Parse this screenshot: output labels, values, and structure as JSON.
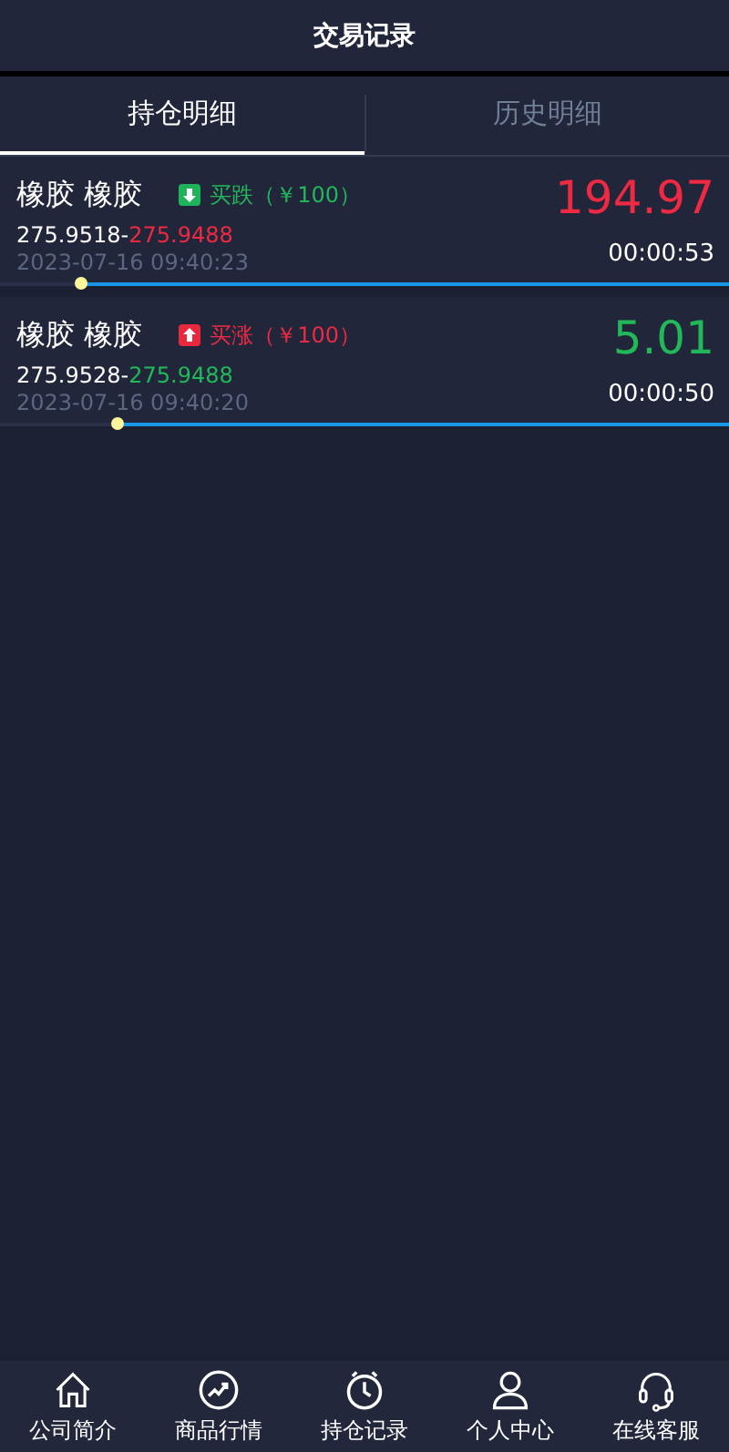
{
  "header": {
    "title": "交易记录"
  },
  "tabs": [
    {
      "label": "持仓明细",
      "selected": true
    },
    {
      "label": "历史明细",
      "selected": false
    }
  ],
  "positions": [
    {
      "name": "橡胶 橡胶",
      "kind": "fall",
      "order": "买跌（￥100）",
      "open_price": "275.9518-",
      "current_price": "275.9488",
      "color": "#ee2a42",
      "amount": "194.97",
      "time": "2023-07-16 09:40:23",
      "countdown": "00:00:53",
      "level": 0.11
    },
    {
      "name": "橡胶 橡胶",
      "kind": "rise",
      "order": "买涨（￥100）",
      "open_price": "275.9528-",
      "current_price": "275.9488",
      "color": "#22b85a",
      "amount": "5.01",
      "time": "2023-07-16 09:40:20",
      "countdown": "00:00:50",
      "level": 0.16
    }
  ],
  "nav": [
    {
      "label": "公司简介",
      "selected": false
    },
    {
      "label": "商品行情",
      "selected": false
    },
    {
      "label": "持仓记录",
      "selected": false
    },
    {
      "label": "个人中心",
      "selected": false
    },
    {
      "label": "在线客服",
      "selected": false
    }
  ]
}
